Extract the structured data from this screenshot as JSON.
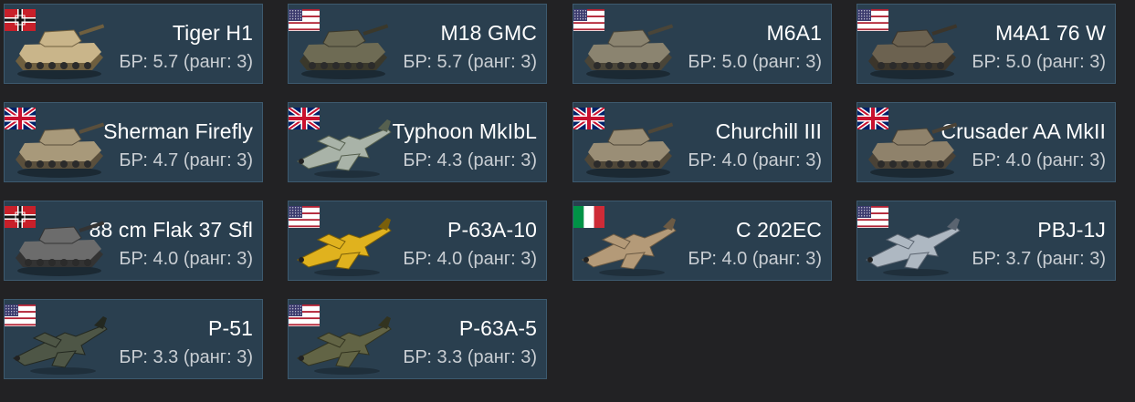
{
  "cards": [
    {
      "name": "Tiger H1",
      "br": "БР: 5.7 (ранг: 3)",
      "flag": "germany-flag-icon",
      "kind": "tank",
      "vehicle_icon": "tank-icon",
      "colors": {
        "body": "#c9b58a",
        "dark": "#6f5f3f"
      }
    },
    {
      "name": "M18 GMC",
      "br": "БР: 5.7 (ранг: 3)",
      "flag": "usa-flag-icon",
      "kind": "tank",
      "vehicle_icon": "tank-icon",
      "colors": {
        "body": "#6e6b54",
        "dark": "#3a382b"
      }
    },
    {
      "name": "M6A1",
      "br": "БР: 5.0 (ранг: 3)",
      "flag": "usa-flag-icon",
      "kind": "tank",
      "vehicle_icon": "tank-icon",
      "colors": {
        "body": "#8b8470",
        "dark": "#4a4538"
      }
    },
    {
      "name": "M4A1 76 W",
      "br": "БР: 5.0 (ранг: 3)",
      "flag": "usa-flag-icon",
      "kind": "tank",
      "vehicle_icon": "tank-icon",
      "colors": {
        "body": "#6c6250",
        "dark": "#3b352b"
      }
    },
    {
      "name": "Sherman Firefly",
      "br": "БР: 4.7 (ранг: 3)",
      "flag": "uk-flag-icon",
      "kind": "tank",
      "vehicle_icon": "tank-icon",
      "colors": {
        "body": "#a8997a",
        "dark": "#5a4f3c"
      }
    },
    {
      "name": "Typhoon MkIbL",
      "br": "БР: 4.3 (ранг: 3)",
      "flag": "uk-flag-icon",
      "kind": "plane",
      "vehicle_icon": "plane-icon",
      "colors": {
        "body": "#a9b3a8",
        "dark": "#56604f"
      }
    },
    {
      "name": "Churchill III",
      "br": "БР: 4.0 (ранг: 3)",
      "flag": "uk-flag-icon",
      "kind": "tank",
      "vehicle_icon": "tank-icon",
      "colors": {
        "body": "#9a8e76",
        "dark": "#4f4738"
      }
    },
    {
      "name": "Crusader AA MkII",
      "br": "БР: 4.0 (ранг: 3)",
      "flag": "uk-flag-icon",
      "kind": "tank",
      "vehicle_icon": "tank-icon",
      "colors": {
        "body": "#8f826b",
        "dark": "#4a4236"
      }
    },
    {
      "name": "88 cm Flak 37 Sfl",
      "br": "БР: 4.0 (ранг: 3)",
      "flag": "germany-flag-icon",
      "kind": "tank",
      "vehicle_icon": "tank-icon",
      "colors": {
        "body": "#6c6c6c",
        "dark": "#333333"
      }
    },
    {
      "name": "P-63A-10",
      "br": "БР: 4.0 (ранг: 3)",
      "flag": "usa-flag-icon",
      "kind": "plane",
      "vehicle_icon": "plane-icon",
      "colors": {
        "body": "#e0b21e",
        "dark": "#7a5f0a"
      }
    },
    {
      "name": "C 202EC",
      "br": "БР: 4.0 (ранг: 3)",
      "flag": "italy-flag-icon",
      "kind": "plane",
      "vehicle_icon": "plane-icon",
      "colors": {
        "body": "#b49a78",
        "dark": "#6b5a44"
      }
    },
    {
      "name": "PBJ-1J",
      "br": "БР: 3.7 (ранг: 3)",
      "flag": "usa-flag-icon",
      "kind": "plane",
      "vehicle_icon": "plane-icon",
      "colors": {
        "body": "#aeb8c2",
        "dark": "#5a6470"
      }
    },
    {
      "name": "P-51",
      "br": "БР: 3.3 (ранг: 3)",
      "flag": "usa-flag-icon",
      "kind": "plane",
      "vehicle_icon": "plane-icon",
      "colors": {
        "body": "#4e5646",
        "dark": "#232820"
      }
    },
    {
      "name": "P-63A-5",
      "br": "БР: 3.3 (ранг: 3)",
      "flag": "usa-flag-icon",
      "kind": "plane",
      "vehicle_icon": "plane-icon",
      "colors": {
        "body": "#626445",
        "dark": "#32331f"
      }
    }
  ],
  "theme": {
    "card_bg": "#2a3f4f",
    "card_border": "#3d5a6f",
    "page_bg": "#222224",
    "name_color": "#ffffff",
    "br_color": "#c9ced3"
  }
}
